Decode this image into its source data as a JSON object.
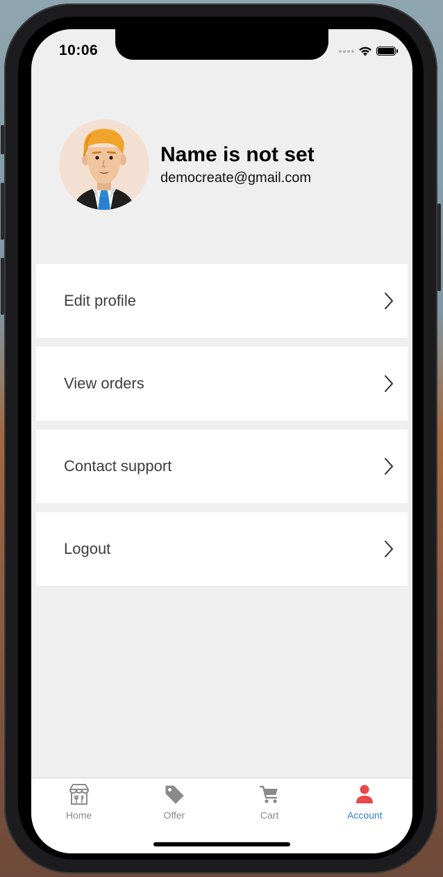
{
  "status_bar": {
    "time": "10:06",
    "icons": [
      "signal-dots-icon",
      "wifi-icon",
      "battery-icon"
    ]
  },
  "profile": {
    "name": "Name is not set",
    "email": "democreate@gmail.com",
    "avatar_icon": "man-avatar-icon"
  },
  "menu": {
    "items": [
      {
        "label": "Edit profile",
        "icon": "chevron-right-icon"
      },
      {
        "label": "View orders",
        "icon": "chevron-right-icon"
      },
      {
        "label": "Contact support",
        "icon": "chevron-right-icon"
      },
      {
        "label": "Logout",
        "icon": "chevron-right-icon"
      }
    ]
  },
  "tab_bar": {
    "tabs": [
      {
        "label": "Home",
        "icon": "storefront-icon",
        "active": false
      },
      {
        "label": "Offer",
        "icon": "tag-icon",
        "active": false
      },
      {
        "label": "Cart",
        "icon": "cart-icon",
        "active": false
      },
      {
        "label": "Account",
        "icon": "person-icon",
        "active": true
      }
    ],
    "active_color": "#2f7fd8",
    "active_icon_color": "#e8474b",
    "inactive_color": "#8a8a8a"
  }
}
